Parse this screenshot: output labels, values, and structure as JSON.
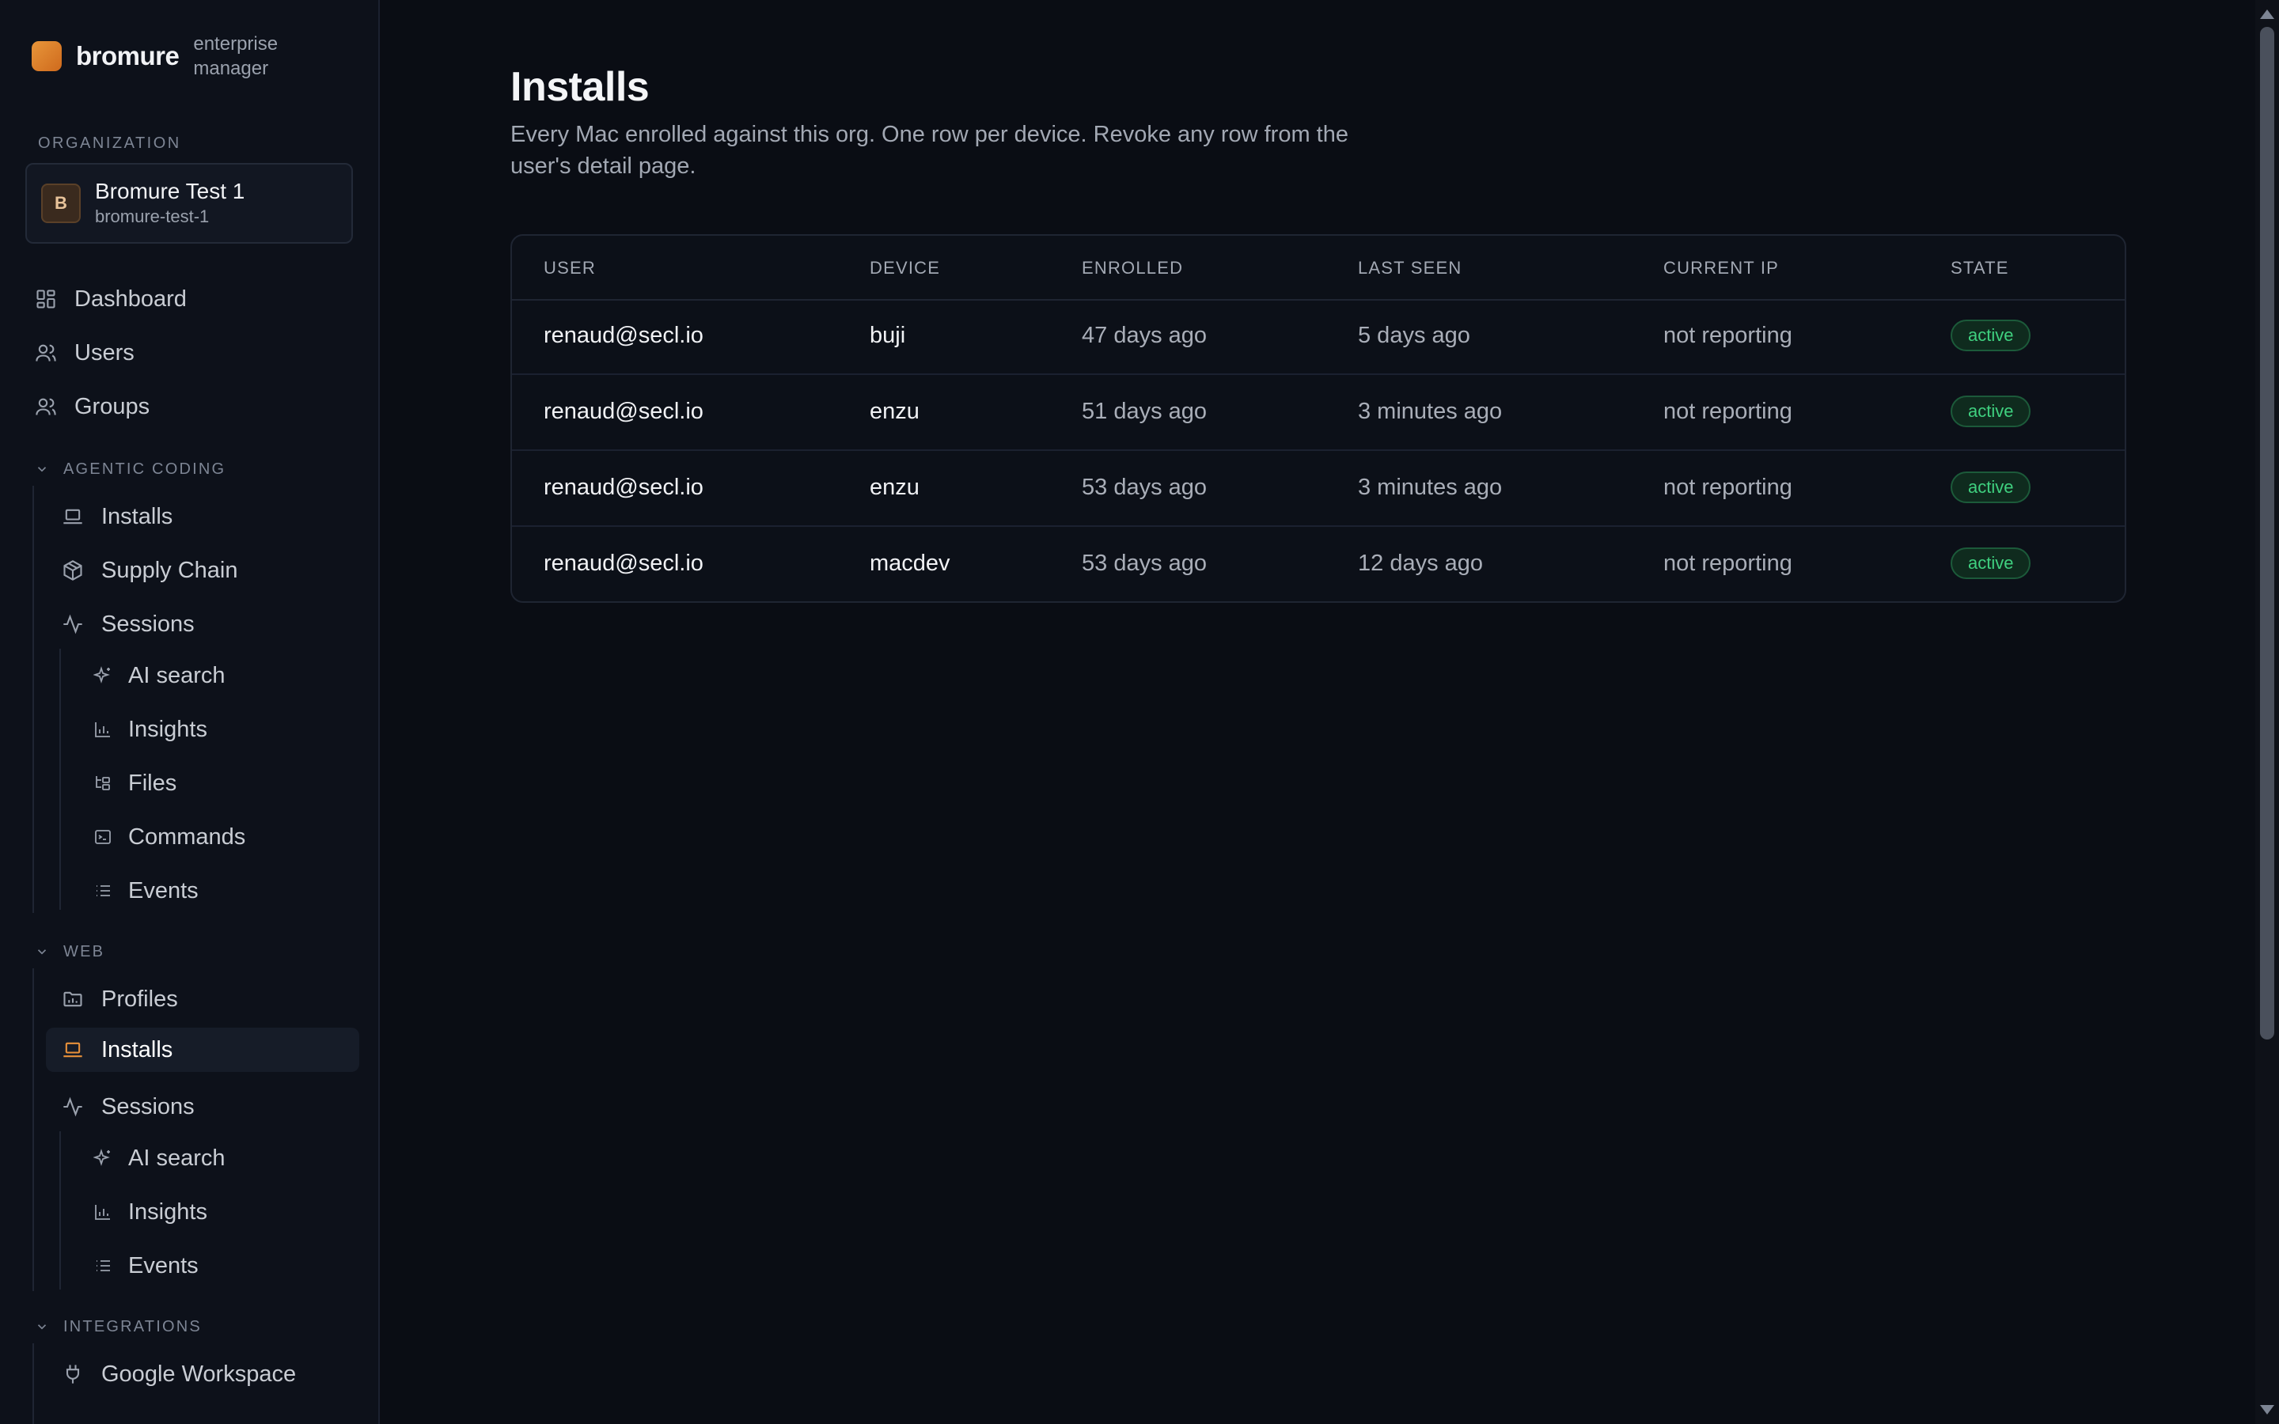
{
  "brand": {
    "name": "bromure",
    "subtitle": "enterprise manager"
  },
  "organization": {
    "section_label": "ORGANIZATION",
    "avatar_letter": "B",
    "name": "Bromure Test 1",
    "slug": "bromure-test-1"
  },
  "nav": {
    "dashboard": "Dashboard",
    "users": "Users",
    "groups": "Groups"
  },
  "agentic_coding": {
    "label": "AGENTIC CODING",
    "installs": "Installs",
    "supply_chain": "Supply Chain",
    "sessions": "Sessions",
    "ai_search": "AI search",
    "insights": "Insights",
    "files": "Files",
    "commands": "Commands",
    "events": "Events"
  },
  "web": {
    "label": "WEB",
    "profiles": "Profiles",
    "installs": "Installs",
    "sessions": "Sessions",
    "ai_search": "AI search",
    "insights": "Insights",
    "events": "Events"
  },
  "integrations": {
    "label": "INTEGRATIONS",
    "google_workspace": "Google Workspace"
  },
  "page": {
    "title": "Installs",
    "description": "Every Mac enrolled against this org. One row per device. Revoke any row from the user's detail page."
  },
  "table": {
    "columns": [
      "USER",
      "DEVICE",
      "ENROLLED",
      "LAST SEEN",
      "CURRENT IP",
      "STATE"
    ],
    "rows": [
      {
        "user": "renaud@secl.io",
        "device": "buji",
        "enrolled": "47 days ago",
        "last_seen": "5 days ago",
        "current_ip": "not reporting",
        "state": "active"
      },
      {
        "user": "renaud@secl.io",
        "device": "enzu",
        "enrolled": "51 days ago",
        "last_seen": "3 minutes ago",
        "current_ip": "not reporting",
        "state": "active"
      },
      {
        "user": "renaud@secl.io",
        "device": "enzu",
        "enrolled": "53 days ago",
        "last_seen": "3 minutes ago",
        "current_ip": "not reporting",
        "state": "active"
      },
      {
        "user": "renaud@secl.io",
        "device": "macdev",
        "enrolled": "53 days ago",
        "last_seen": "12 days ago",
        "current_ip": "not reporting",
        "state": "active"
      }
    ]
  },
  "colors": {
    "accent": "#e8913a",
    "status_active": "#3fd07f",
    "background": "#0a0d14"
  }
}
